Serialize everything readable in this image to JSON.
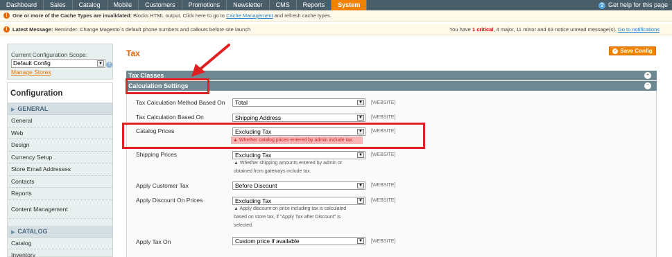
{
  "topnav": {
    "items": [
      "Dashboard",
      "Sales",
      "Catalog",
      "Mobile",
      "Customers",
      "Promotions",
      "Newsletter",
      "CMS",
      "Reports",
      "System"
    ],
    "active": "System",
    "help": "Get help for this page"
  },
  "notices": {
    "cache_bold": "One or more of the Cache Types are invalidated:",
    "cache_text": "Blocks HTML output. Click here to go to",
    "cache_link": "Cache Management",
    "cache_tail": "and refresh cache types.",
    "latest_bold": "Latest Message:",
    "latest_text": "Reminder: Change Magento`s default phone numbers and callouts before site launch",
    "summary_pre": "You have",
    "summary_critical": "1 critical",
    "summary_rest": ", 4 major, 11 minor and 63 notice unread message(s).",
    "summary_link": "Go to notifications"
  },
  "sidebar": {
    "scope_label": "Current Configuration Scope:",
    "scope_value": "Default Config",
    "manage_stores": "Manage Stores",
    "title": "Configuration",
    "group_general": "GENERAL",
    "general_items": [
      "General",
      "Web",
      "Design",
      "Currency Setup",
      "Store Email Addresses",
      "Contacts",
      "Reports",
      "Content Management"
    ],
    "group_catalog": "CATALOG",
    "catalog_items": [
      "Catalog",
      "Inventory"
    ]
  },
  "main": {
    "title": "Tax",
    "save_label": "Save Config",
    "section_tax_classes": "Tax Classes",
    "section_calc": "Calculation Settings",
    "rows": [
      {
        "label": "Tax Calculation Method Based On",
        "value": "Total",
        "scope": "[WEBSITE]"
      },
      {
        "label": "Tax Calculation Based On",
        "value": "Shipping Address",
        "scope": "[WEBSITE]"
      },
      {
        "label": "Catalog Prices",
        "value": "Excluding Tax",
        "scope": "[WEBSITE]",
        "note": "Whether catalog prices entered by admin include tax."
      },
      {
        "label": "Shipping Prices",
        "value": "Excluding Tax",
        "scope": "[WEBSITE]",
        "note1": "Whether shipping amounts entered by admin or",
        "note2": "obtained from gateways include tax."
      },
      {
        "label": "Apply Customer Tax",
        "value": "Before Discount",
        "scope": "[WEBSITE]"
      },
      {
        "label": "Apply Discount On Prices",
        "value": "Excluding Tax",
        "scope": "[WEBSITE]",
        "note1": "Apply discount on price including tax is calculated",
        "note2": "based on store tax, if \"Apply Tax after Discount\" is",
        "note3": "selected."
      },
      {
        "label": "Apply Tax On",
        "value": "Custom price if available",
        "scope": "[WEBSITE]"
      }
    ]
  },
  "colors": {
    "accent": "#f18200",
    "nav": "#4a5e6a",
    "section_header": "#6f8992",
    "highlight": "#e02020"
  }
}
